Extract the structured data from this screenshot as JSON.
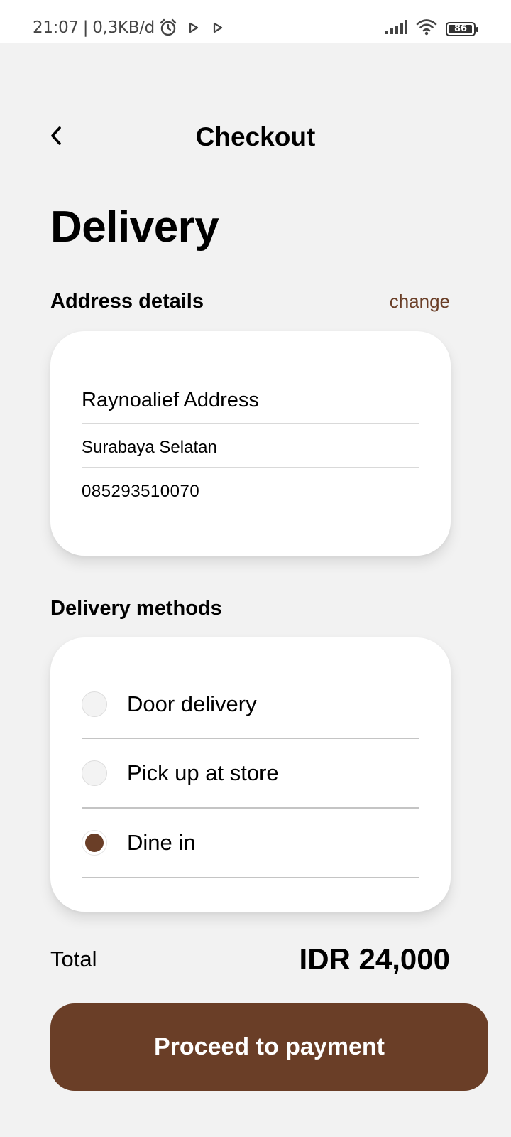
{
  "status_bar": {
    "time": "21:07",
    "separator": "|",
    "data_rate": "0,3KB/d",
    "battery_level": "86",
    "left_icons": [
      "alarm-icon",
      "play-icon",
      "play-icon"
    ],
    "right_icons": [
      "signal-icon",
      "wifi-icon",
      "battery-icon"
    ]
  },
  "header": {
    "back_icon": "chevron-left-icon",
    "title": "Checkout"
  },
  "page_heading": "Delivery",
  "address": {
    "label": "Address details",
    "change_label": "change",
    "name": "Raynoalief Address",
    "area": "Surabaya Selatan",
    "phone": "085293510070"
  },
  "delivery_methods": {
    "label": "Delivery methods",
    "options": [
      {
        "label": "Door delivery",
        "selected": false
      },
      {
        "label": "Pick up at store",
        "selected": false
      },
      {
        "label": "Dine in",
        "selected": true
      }
    ]
  },
  "total": {
    "label": "Total",
    "value": "IDR 24,000"
  },
  "proceed_button": "Proceed to payment",
  "colors": {
    "accent": "#6a3e27",
    "background": "#f2f2f2",
    "card": "#ffffff"
  }
}
